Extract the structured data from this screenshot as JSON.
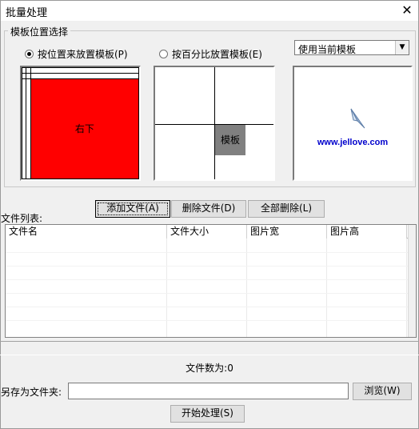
{
  "window": {
    "title": "批量处理",
    "close_glyph": "✕"
  },
  "position_group": {
    "title": "模板位置选择",
    "radio_by_position": {
      "label": "按位置来放置模板(P)",
      "checked": true
    },
    "radio_by_percent": {
      "label": "按百分比放置模板(E)",
      "checked": false
    },
    "template_select": {
      "value": "使用当前模板",
      "arrow": "▼"
    },
    "grid_selected_label": "右下",
    "percent_marker_label": "模板",
    "preview": {
      "icon": "paper-plane-icon",
      "url_text": "www.jellove.com"
    }
  },
  "buttons": {
    "add_files": "添加文件(A)",
    "remove_file": "删除文件(D)",
    "remove_all": "全部删除(L)",
    "browse": "浏览(W)",
    "start": "开始处理(S)"
  },
  "file_list": {
    "label": "文件列表:",
    "columns": [
      "文件名",
      "文件大小",
      "图片宽",
      "图片高"
    ],
    "rows": []
  },
  "status": {
    "file_count": "文件数为:0"
  },
  "save": {
    "label": "另存为文件夹:",
    "value": ""
  },
  "colors": {
    "selected_cell": "#ff0000",
    "marker": "#808080",
    "url": "#0000cc"
  }
}
